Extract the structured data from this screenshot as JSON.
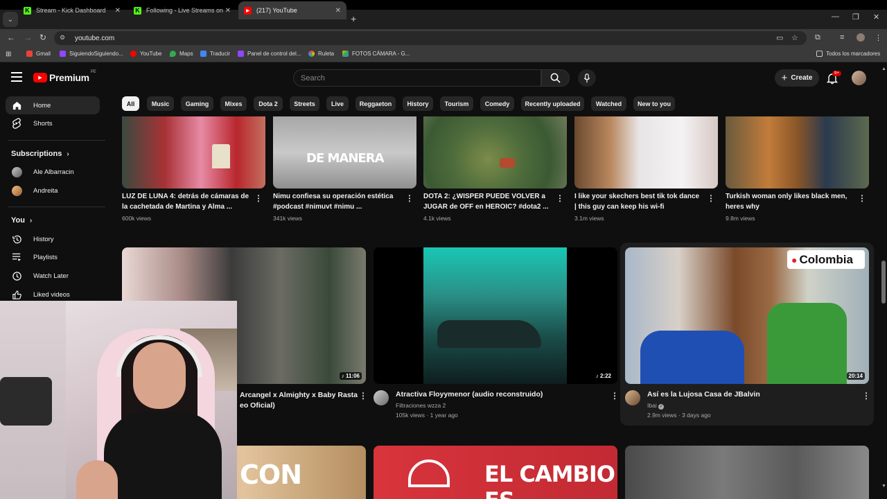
{
  "browser": {
    "tabs": [
      {
        "title": "Stream - Kick Dashboard",
        "icon": "kick-icon"
      },
      {
        "title": "Following - Live Streams on Kic",
        "icon": "kick-icon"
      },
      {
        "title": "(217) YouTube",
        "icon": "youtube-icon",
        "active": true
      }
    ],
    "url": "youtube.com",
    "bookmarks": [
      "Gmail",
      "SiguiendoSiguiendo...",
      "YouTube",
      "Maps",
      "Traducir",
      "Panel de control del...",
      "Ruleta",
      "FOTOS CÁMARA - G..."
    ],
    "all_bookmarks": "Todos los marcadores"
  },
  "header": {
    "logo": "Premium",
    "logo_country": "PE",
    "search_placeholder": "Search",
    "create_label": "Create",
    "notif_badge": "9+"
  },
  "sidebar": {
    "items": [
      {
        "label": "Home",
        "icon": "home-icon"
      },
      {
        "label": "Shorts",
        "icon": "shorts-icon"
      }
    ],
    "subscriptions_label": "Subscriptions",
    "subscriptions": [
      {
        "label": "Ale Albarracin"
      },
      {
        "label": "Andreita"
      }
    ],
    "you_label": "You",
    "you_items": [
      {
        "label": "History",
        "icon": "history-icon"
      },
      {
        "label": "Playlists",
        "icon": "playlists-icon"
      },
      {
        "label": "Watch Later",
        "icon": "watch-later-icon"
      },
      {
        "label": "Liked videos",
        "icon": "like-icon"
      }
    ]
  },
  "chips": [
    "All",
    "Music",
    "Gaming",
    "Mixes",
    "Dota 2",
    "Streets",
    "Live",
    "Reggaeton",
    "History",
    "Tourism",
    "Comedy",
    "Recently uploaded",
    "Watched",
    "New to you"
  ],
  "row1": [
    {
      "title1": "LUZ DE LUNA 4: detrás de cámaras de",
      "title2": "la cachetada de Martina y Alma ...",
      "views": "600k views"
    },
    {
      "title1": "Nimu confiesa su operación estética",
      "title2": "#podcast #nimuvt #nimu ...",
      "views": "341k views",
      "overlay": "DE MANERA"
    },
    {
      "title1": "DOTA 2: ¿WISPER PUEDE VOLVER a",
      "title2": "JUGAR de OFF en HEROIC? #dota2 ...",
      "views": "4.1k views"
    },
    {
      "title1": "I like your skechers best tik tok dance",
      "title2": "| this guy can keep his wi-fi",
      "views": "3.1m views"
    },
    {
      "title1": "Turkish woman only likes black men,",
      "title2": "heres why",
      "views": "9.8m views"
    }
  ],
  "row2": [
    {
      "title1": "Arcangel x Almighty x Baby Rasta",
      "title2": "eo Oficial)",
      "duration": "11:06"
    },
    {
      "title1": "Atractiva Floyymenor (audio reconstruido)",
      "channel": "Filtraciones wzza 2",
      "meta": "105k views · 1 year ago",
      "duration": "2:22"
    },
    {
      "title1": "Así es la Lujosa Casa de JBalvin",
      "channel": "Ibai",
      "meta": "2.9m views · 3 days ago",
      "overlay": "Colombia",
      "duration": "20:14"
    }
  ],
  "row3": [
    {
      "overlay": "CON"
    },
    {
      "overlay": "EL CAMBIO ES"
    }
  ]
}
